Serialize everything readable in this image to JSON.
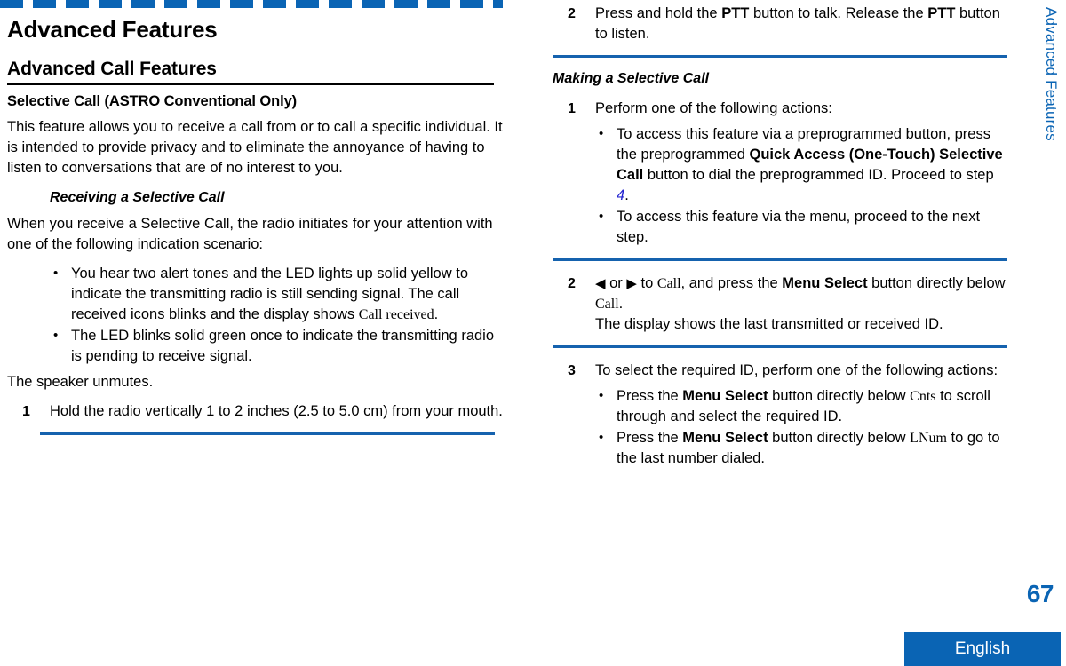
{
  "document": {
    "chapter_title": "Advanced Features",
    "section_title": "Advanced Call Features",
    "subsection_title": "Selective Call (ASTRO Conventional Only)",
    "side_tab_label": "Advanced Features",
    "page_number": "67",
    "language_tab": "English"
  },
  "left_column": {
    "intro_paragraph": "This feature allows you to receive a call from or to call a specific individual. It is intended to provide privacy and to eliminate the annoyance of having to listen to conversations that are of no interest to you.",
    "receiving_heading": "Receiving a Selective Call",
    "receiving_lead": "When you receive a Selective Call, the radio initiates for your attention with one of the following indication scenario:",
    "bullets": [
      {
        "text_before": "You hear two alert tones and the LED lights up solid yellow to indicate the transmitting radio is still sending signal. The call received icons blinks and the display shows ",
        "screen_text": "Call received",
        "text_after": "."
      },
      {
        "text_before": "The LED blinks solid green once to indicate the transmitting radio is pending to receive signal.",
        "screen_text": "",
        "text_after": ""
      }
    ],
    "speaker_note": "The speaker unmutes.",
    "step1": {
      "number": "1",
      "text": "Hold the radio vertically 1 to 2 inches (2.5 to 5.0 cm) from your mouth."
    }
  },
  "right_column": {
    "step2_top": {
      "number": "2",
      "part1": "Press and hold the ",
      "bold1": "PTT",
      "part2": " button to talk. Release the ",
      "bold2": "PTT",
      "part3": " button to listen."
    },
    "making_heading": "Making a Selective Call",
    "step1": {
      "number": "1",
      "text": "Perform one of the following actions:"
    },
    "step1_bullets": [
      {
        "part1": "To access this feature via a preprogrammed button, press the preprogrammed ",
        "bold1": "Quick Access (One-Touch) Selective Call",
        "part2": " button to dial the preprogrammed ID. Proceed to step ",
        "xref": "4",
        "part3": "."
      },
      {
        "part1": "To access this feature via the menu, proceed to the next step.",
        "bold1": "",
        "part2": "",
        "xref": "",
        "part3": ""
      }
    ],
    "step2": {
      "number": "2",
      "arrow_left": "◀",
      "or_text": " or ",
      "arrow_right": "▶",
      "part1": " to ",
      "screen1": "Call",
      "part2": ", and press the ",
      "bold1": "Menu Select",
      "part3": " button directly below ",
      "screen2": "Call",
      "part4": ".",
      "line2": "The display shows the last transmitted or received ID."
    },
    "step3": {
      "number": "3",
      "text": "To select the required ID, perform one of the following actions:",
      "bullets": [
        {
          "part1": "Press the ",
          "bold1": "Menu Select",
          "part2": " button directly below ",
          "screen1": "Cnts",
          "part3": " to scroll through and select the required ID."
        },
        {
          "part1": "Press the ",
          "bold1": "Menu Select",
          "part2": " button directly below ",
          "screen1": "LNum",
          "part3": " to go to the last number dialed."
        }
      ]
    }
  },
  "colors": {
    "brand_blue": "#0a64b4",
    "rule_blue": "#1562ae",
    "xref_blue": "#2323d0",
    "text_black": "#000000"
  }
}
